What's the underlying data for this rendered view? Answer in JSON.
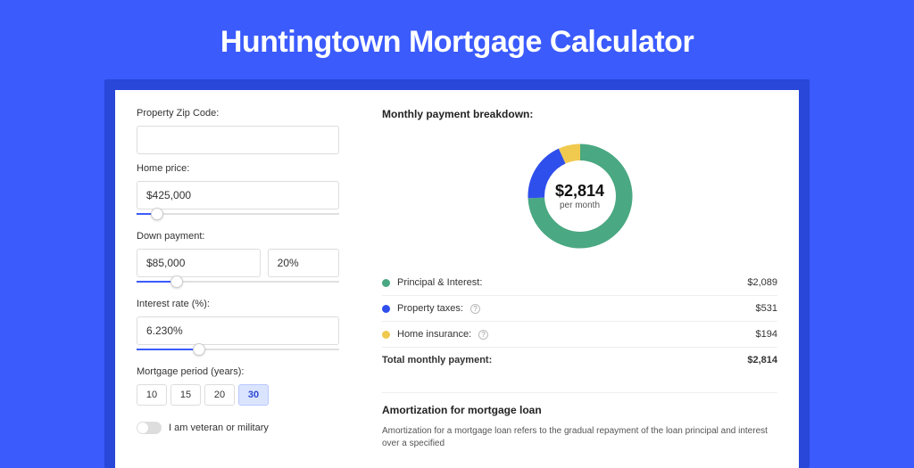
{
  "title": "Huntingtown Mortgage Calculator",
  "form": {
    "zip_label": "Property Zip Code:",
    "zip_value": "",
    "price_label": "Home price:",
    "price_value": "$425,000",
    "down_label": "Down payment:",
    "down_value": "$85,000",
    "down_pct": "20%",
    "rate_label": "Interest rate (%):",
    "rate_value": "6.230%",
    "period_label": "Mortgage period (years):",
    "period_options": [
      "10",
      "15",
      "20",
      "30"
    ],
    "period_selected": "30",
    "veteran_label": "I am veteran or military"
  },
  "breakdown": {
    "title": "Monthly payment breakdown:",
    "center_amount": "$2,814",
    "center_sub": "per month",
    "items": [
      {
        "label": "Principal & Interest:",
        "amount": "$2,089",
        "color": "#4aa882",
        "info": false
      },
      {
        "label": "Property taxes:",
        "amount": "$531",
        "color": "#2f4fec",
        "info": true
      },
      {
        "label": "Home insurance:",
        "amount": "$194",
        "color": "#f0c94f",
        "info": true
      }
    ],
    "total_label": "Total monthly payment:",
    "total_amount": "$2,814"
  },
  "amort": {
    "title": "Amortization for mortgage loan",
    "text": "Amortization for a mortgage loan refers to the gradual repayment of the loan principal and interest over a specified"
  },
  "chart_data": {
    "type": "pie",
    "title": "Monthly payment breakdown",
    "series": [
      {
        "name": "Principal & Interest",
        "value": 2089,
        "color": "#4aa882"
      },
      {
        "name": "Property taxes",
        "value": 531,
        "color": "#2f4fec"
      },
      {
        "name": "Home insurance",
        "value": 194,
        "color": "#f0c94f"
      }
    ],
    "total": 2814,
    "center_label": "$2,814 per month"
  }
}
